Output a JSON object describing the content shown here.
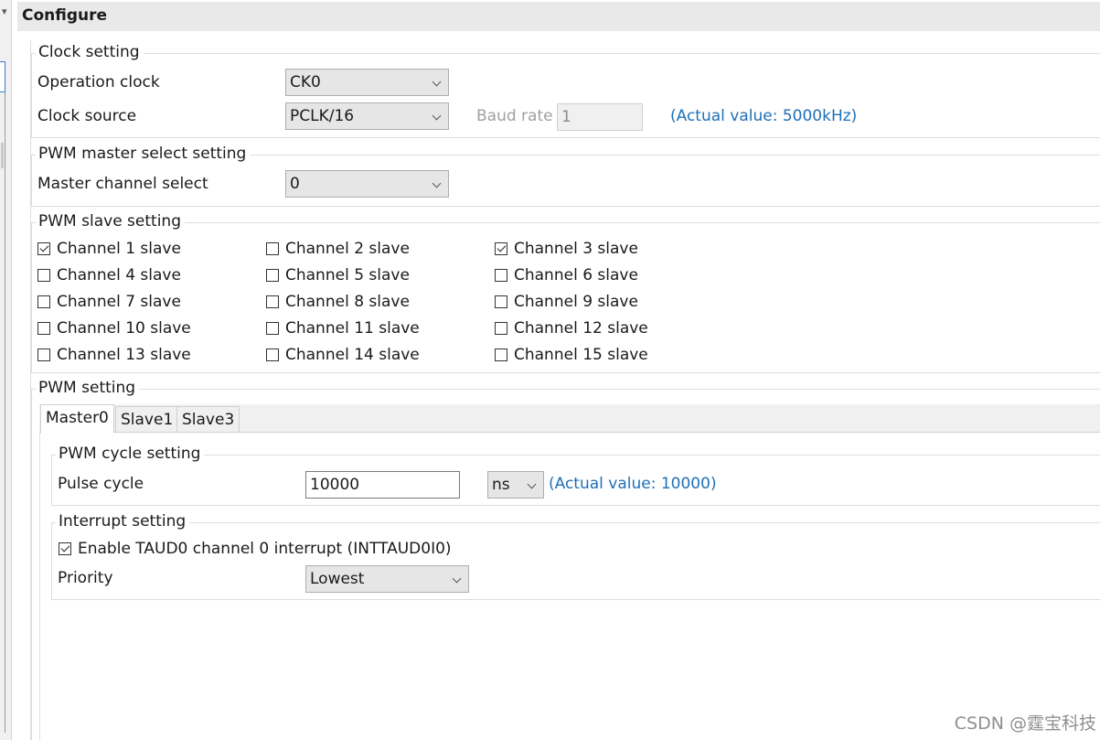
{
  "app": {
    "panel_title": "Configure"
  },
  "clock_setting": {
    "legend": "Clock setting",
    "operation_clock_label": "Operation clock",
    "operation_clock_value": "CK0",
    "clock_source_label": "Clock source",
    "clock_source_value": "PCLK/16",
    "baud_rate_label": "Baud rate",
    "baud_rate_value": "1",
    "actual_value": "(Actual value: 5000kHz)"
  },
  "master_select": {
    "legend": "PWM master select setting",
    "label": "Master channel select",
    "value": "0"
  },
  "slave_setting": {
    "legend": "PWM slave setting",
    "channels": [
      {
        "label": "Channel 1 slave",
        "checked": true
      },
      {
        "label": "Channel 2 slave",
        "checked": false
      },
      {
        "label": "Channel 3 slave",
        "checked": true
      },
      {
        "label": "Channel 4 slave",
        "checked": false
      },
      {
        "label": "Channel 5 slave",
        "checked": false
      },
      {
        "label": "Channel 6 slave",
        "checked": false
      },
      {
        "label": "Channel 7 slave",
        "checked": false
      },
      {
        "label": "Channel 8 slave",
        "checked": false
      },
      {
        "label": "Channel 9 slave",
        "checked": false
      },
      {
        "label": "Channel 10 slave",
        "checked": false
      },
      {
        "label": "Channel 11 slave",
        "checked": false
      },
      {
        "label": "Channel 12 slave",
        "checked": false
      },
      {
        "label": "Channel 13 slave",
        "checked": false
      },
      {
        "label": "Channel 14 slave",
        "checked": false
      },
      {
        "label": "Channel 15 slave",
        "checked": false
      }
    ]
  },
  "pwm_setting": {
    "legend": "PWM setting",
    "tabs": [
      {
        "label": "Master0",
        "active": true
      },
      {
        "label": "Slave1",
        "active": false
      },
      {
        "label": "Slave3",
        "active": false
      }
    ],
    "cycle": {
      "legend": "PWM cycle setting",
      "pulse_cycle_label": "Pulse cycle",
      "pulse_cycle_value": "10000",
      "unit_value": "ns",
      "actual_value": "(Actual value: 10000)"
    },
    "interrupt": {
      "legend": "Interrupt setting",
      "enable_label": "Enable TAUD0 channel 0 interrupt (INTTAUD0I0)",
      "enable_checked": true,
      "priority_label": "Priority",
      "priority_value": "Lowest"
    }
  },
  "watermark": "CSDN @霆宝科技"
}
